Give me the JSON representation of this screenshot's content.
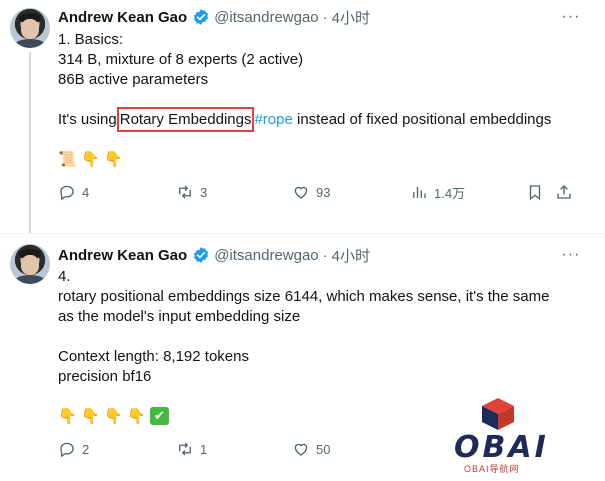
{
  "tweets": [
    {
      "author": "Andrew Kean Gao",
      "handle": "@itsandrewgao",
      "time": "4小时",
      "lines": [
        "1. Basics:",
        "314 B, mixture of 8 experts (2 active)",
        "86B active parameters"
      ],
      "para_prefix": "It's using",
      "para_highlight": "Rotary Embeddings",
      "para_hashtag": "#rope",
      "para_suffix": " instead of fixed positional embeddings",
      "emoji": [
        "📜",
        "👇",
        "👇"
      ],
      "actions": {
        "replies": "4",
        "retweets": "3",
        "likes": "93",
        "views": "1.4万"
      }
    },
    {
      "author": "Andrew Kean Gao",
      "handle": "@itsandrewgao",
      "time": "4小时",
      "lines": [
        "4.",
        "rotary positional embeddings size 6144, which makes sense, it's the same",
        "as the model's input embedding size",
        "Context length: 8,192 tokens",
        "precision bf16"
      ],
      "emoji": [
        "👇",
        "👇",
        "👇",
        "👇"
      ],
      "emoji_check": "✔",
      "actions": {
        "replies": "2",
        "retweets": "1",
        "likes": "50"
      }
    }
  ],
  "more_label": "···",
  "watermark": {
    "title": "OBAI",
    "subtitle": "OBAI导航网"
  },
  "colors": {
    "link": "#1d9bf0",
    "text": "#0f1419",
    "secondary": "#536471",
    "highlight_box": "#e0423b"
  },
  "icons": [
    "verified-badge-icon",
    "reply-icon",
    "retweet-icon",
    "like-icon",
    "views-icon",
    "bookmark-icon",
    "share-icon",
    "more-icon"
  ]
}
